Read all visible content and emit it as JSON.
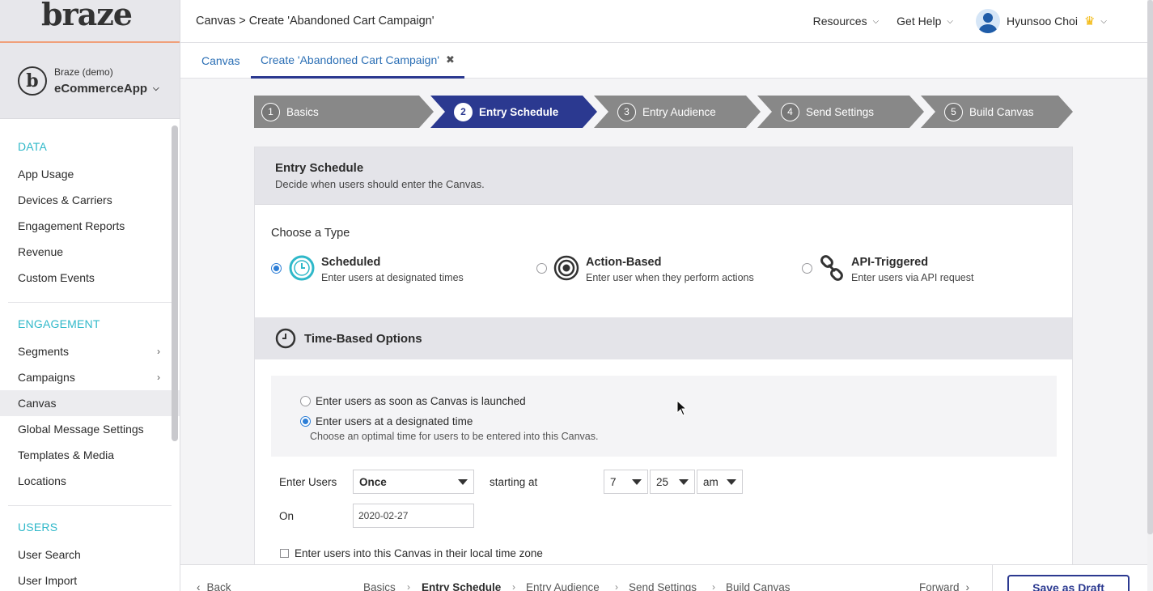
{
  "brand": {
    "logo_text": "braze"
  },
  "account": {
    "org": "Braze (demo)",
    "app": "eCommerceApp",
    "logo_letter": "b"
  },
  "nav": {
    "sections": [
      {
        "title": "DATA",
        "items": [
          "App Usage",
          "Devices & Carriers",
          "Engagement Reports",
          "Revenue",
          "Custom Events"
        ]
      },
      {
        "title": "ENGAGEMENT",
        "items": [
          "Segments",
          "Campaigns",
          "Canvas",
          "Global Message Settings",
          "Templates & Media",
          "Locations"
        ]
      },
      {
        "title": "USERS",
        "items": [
          "User Search",
          "User Import"
        ]
      }
    ],
    "active_item": "Canvas"
  },
  "topbar": {
    "breadcrumb": "Canvas > Create 'Abandoned Cart Campaign'",
    "resources": "Resources",
    "get_help": "Get Help",
    "user_name": "Hyunsoo Choi"
  },
  "tabs": [
    {
      "label": "Canvas"
    },
    {
      "label": "Create 'Abandoned Cart Campaign'"
    }
  ],
  "steps": [
    {
      "num": "1",
      "label": "Basics"
    },
    {
      "num": "2",
      "label": "Entry Schedule"
    },
    {
      "num": "3",
      "label": "Entry Audience"
    },
    {
      "num": "4",
      "label": "Send Settings"
    },
    {
      "num": "5",
      "label": "Build Canvas"
    }
  ],
  "entry_schedule": {
    "title": "Entry Schedule",
    "subtitle": "Decide when users should enter the Canvas.",
    "choose_type": "Choose a Type",
    "types": [
      {
        "name": "Scheduled",
        "desc": "Enter users at designated times"
      },
      {
        "name": "Action-Based",
        "desc": "Enter user when they perform actions"
      },
      {
        "name": "API-Triggered",
        "desc": "Enter users via API request"
      }
    ],
    "selected_type": "Scheduled"
  },
  "time_based": {
    "title": "Time-Based Options",
    "option_launch": "Enter users as soon as Canvas is launched",
    "option_designated": "Enter users at a designated time",
    "option_designated_sub": "Choose an optimal time for users to be entered into this Canvas.",
    "enter_users_label": "Enter Users",
    "frequency": "Once",
    "starting_at_label": "starting at",
    "hour": "7",
    "minute": "25",
    "ampm": "am",
    "on_label": "On",
    "date": "2020-02-27",
    "local_tz_label": "Enter users into this Canvas in their local time zone"
  },
  "footer": {
    "back": "Back",
    "forward": "Forward",
    "steps": [
      "Basics",
      "Entry Schedule",
      "Entry Audience",
      "Send Settings",
      "Build Canvas"
    ],
    "save_draft": "Save as Draft"
  },
  "colors": {
    "primary": "#2b3990",
    "accent_teal": "#2fb8c9",
    "link": "#2b6fb5",
    "radio": "#2d7ed6"
  }
}
